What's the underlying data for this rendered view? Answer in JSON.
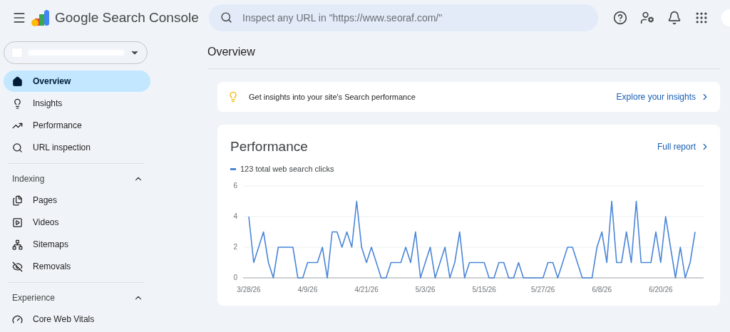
{
  "header": {
    "product_name": "Google Search Console",
    "search": {
      "placeholder": "Inspect any URL in \"https://www.seoraf.com/\""
    }
  },
  "sidebar": {
    "top_items": [
      {
        "label": "Overview",
        "selected": true
      },
      {
        "label": "Insights",
        "selected": false
      },
      {
        "label": "Performance",
        "selected": false
      },
      {
        "label": "URL inspection",
        "selected": false
      }
    ],
    "sections": [
      {
        "title": "Indexing",
        "expanded": true,
        "items": [
          {
            "label": "Pages",
            "selected": false
          },
          {
            "label": "Videos",
            "selected": false
          },
          {
            "label": "Sitemaps",
            "selected": false
          },
          {
            "label": "Removals",
            "selected": false
          }
        ]
      },
      {
        "title": "Experience",
        "expanded": true,
        "items": [
          {
            "label": "Core Web Vitals",
            "selected": false
          }
        ]
      }
    ]
  },
  "page_title": "Overview",
  "insights_card": {
    "text": "Get insights into your site's Search performance",
    "link": "Explore your insights"
  },
  "performance_card": {
    "title": "Performance",
    "link": "Full report",
    "legend": "123 total web search clicks",
    "chart_data": {
      "type": "line",
      "ylim": [
        0,
        6
      ],
      "yticks": [
        0,
        2,
        4,
        6
      ],
      "categories": [
        "3/28/26",
        null,
        null,
        null,
        null,
        null,
        null,
        null,
        null,
        null,
        null,
        null,
        "4/9/26",
        null,
        null,
        null,
        null,
        null,
        null,
        null,
        null,
        null,
        null,
        null,
        "4/21/26",
        null,
        null,
        null,
        null,
        null,
        null,
        null,
        null,
        null,
        null,
        null,
        "5/3/26",
        null,
        null,
        null,
        null,
        null,
        null,
        null,
        null,
        null,
        null,
        null,
        "5/15/26",
        null,
        null,
        null,
        null,
        null,
        null,
        null,
        null,
        null,
        null,
        null,
        "5/27/26",
        null,
        null,
        null,
        null,
        null,
        null,
        null,
        null,
        null,
        null,
        null,
        "6/8/26",
        null,
        null,
        null,
        null,
        null,
        null,
        null,
        null,
        null,
        null,
        null,
        "6/20/26",
        null,
        null,
        null,
        null,
        null,
        null,
        null
      ],
      "series": [
        {
          "color": "#4a86d8",
          "values": [
            4,
            1,
            2,
            3,
            1,
            0,
            2,
            2,
            2,
            2,
            0,
            0,
            1,
            1,
            1,
            2,
            0,
            3,
            3,
            2,
            3,
            2,
            5,
            2,
            1,
            2,
            1,
            0,
            0,
            1,
            1,
            1,
            2,
            1,
            3,
            0,
            1,
            2,
            0,
            1,
            2,
            0,
            1,
            3,
            0,
            1,
            1,
            1,
            1,
            0,
            0,
            1,
            1,
            0,
            0,
            1,
            0,
            0,
            0,
            0,
            0,
            1,
            1,
            0,
            1,
            2,
            2,
            1,
            0,
            0,
            0,
            2,
            3,
            1,
            5,
            1,
            1,
            3,
            1,
            5,
            1,
            1,
            1,
            3,
            1,
            4,
            2,
            0,
            2,
            0,
            1,
            3
          ]
        }
      ]
    }
  }
}
